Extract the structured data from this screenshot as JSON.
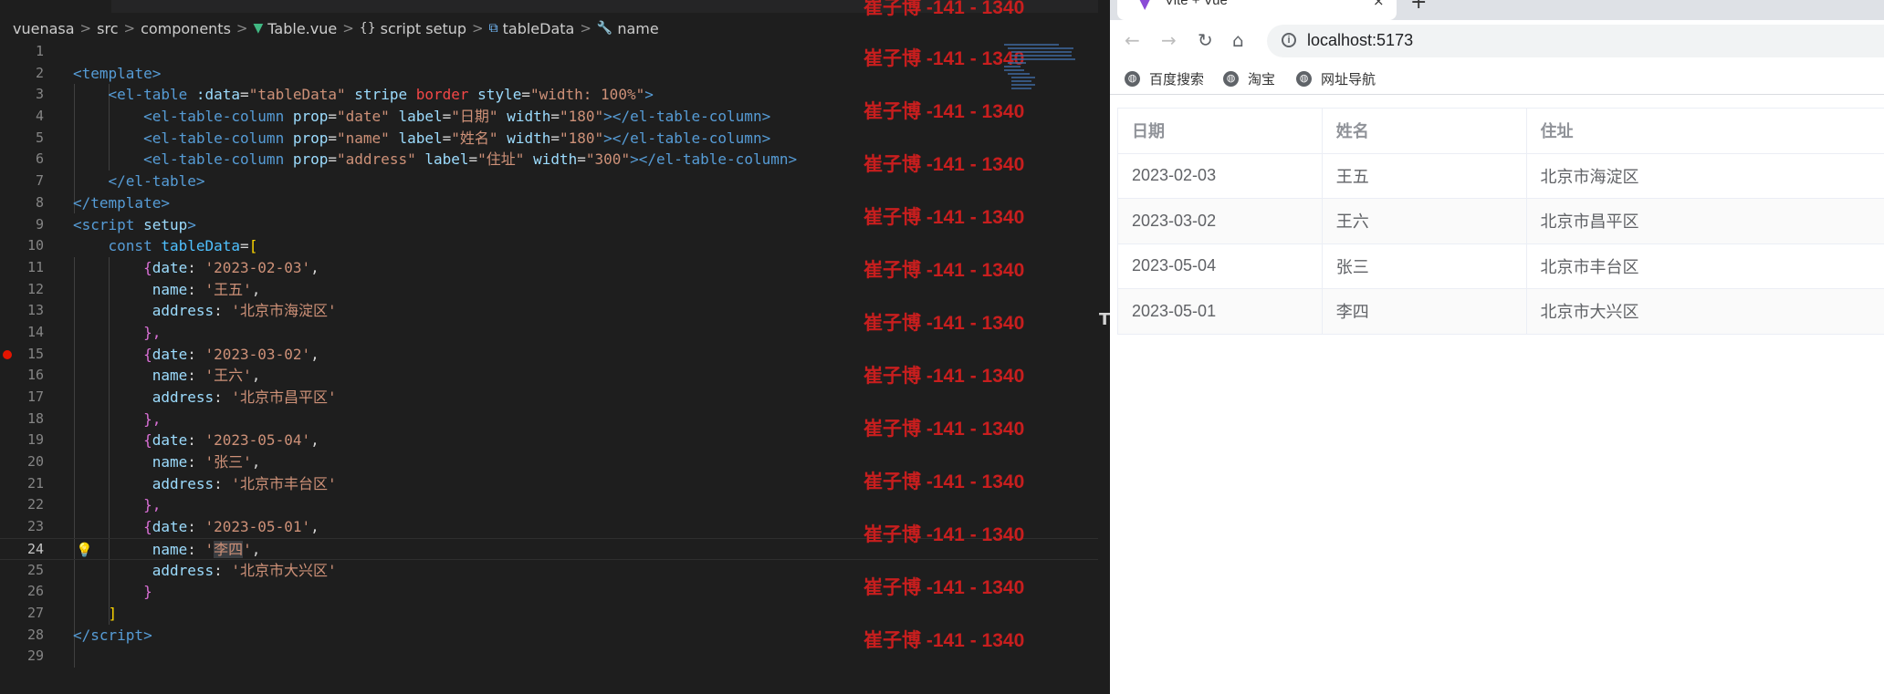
{
  "editor": {
    "breadcrumb": [
      {
        "icon": "none",
        "label": "vuenasa"
      },
      {
        "icon": "none",
        "label": "src"
      },
      {
        "icon": "none",
        "label": "components"
      },
      {
        "icon": "vue-icon",
        "label": "Table.vue"
      },
      {
        "icon": "braces-icon",
        "label": "script setup"
      },
      {
        "icon": "variable-icon",
        "label": "tableData"
      },
      {
        "icon": "wrench-icon",
        "label": "name"
      }
    ],
    "breadcrumb_sep": ">",
    "line_numbers": [
      "1",
      "2",
      "3",
      "4",
      "5",
      "6",
      "7",
      "8",
      "9",
      "10",
      "11",
      "12",
      "13",
      "14",
      "15",
      "16",
      "17",
      "18",
      "19",
      "20",
      "21",
      "22",
      "23",
      "24",
      "25",
      "26",
      "27",
      "28",
      "29"
    ],
    "current_line": "24",
    "breakpoint_line": "15",
    "lightbulb_glyph": "💡",
    "code": {
      "l2": [
        "<",
        "template",
        ">"
      ],
      "l3": [
        "    <",
        "el-table",
        " ",
        ":data",
        "=",
        "\"tableData\"",
        " ",
        "stripe",
        " ",
        "border",
        " ",
        "style",
        "=",
        "\"width: 100%\"",
        ">"
      ],
      "l4": [
        "        <",
        "el-table-column",
        " ",
        "prop",
        "=",
        "\"date\"",
        " ",
        "label",
        "=",
        "\"日期\"",
        " ",
        "width",
        "=",
        "\"180\"",
        "></",
        "el-table-column",
        ">"
      ],
      "l5": [
        "        <",
        "el-table-column",
        " ",
        "prop",
        "=",
        "\"name\"",
        " ",
        "label",
        "=",
        "\"姓名\"",
        " ",
        "width",
        "=",
        "\"180\"",
        "></",
        "el-table-column",
        ">"
      ],
      "l6": [
        "        <",
        "el-table-column",
        " ",
        "prop",
        "=",
        "\"address\"",
        " ",
        "label",
        "=",
        "\"住址\"",
        " ",
        "width",
        "=",
        "\"300\"",
        "></",
        "el-table-column",
        ">"
      ],
      "l7": [
        "    </",
        "el-table",
        ">"
      ],
      "l8": [
        "</",
        "template",
        ">"
      ],
      "l9": [
        "<",
        "script",
        " ",
        "setup",
        ">"
      ],
      "l10": [
        "    ",
        "const",
        " ",
        "tableData",
        "=",
        "["
      ],
      "rows": [
        {
          "date": "'2023-02-03'",
          "name": "'王五'",
          "address": "'北京市海淀区'"
        },
        {
          "date": "'2023-03-02'",
          "name": "'王六'",
          "address": "'北京市昌平区'"
        },
        {
          "date": "'2023-05-04'",
          "name": "'张三'",
          "address": "'北京市丰台区'"
        },
        {
          "date": "'2023-05-01'",
          "name": "李四",
          "address": "'北京市大兴区'"
        }
      ],
      "open_obj": "{",
      "close_obj": "},",
      "close_last": "}",
      "key_date": "date",
      "key_name": "name",
      "key_address": "address",
      "colon": ": ",
      "comma": ",",
      "quote": "'",
      "l27": "]",
      "l28": [
        "</",
        "script",
        ">"
      ]
    },
    "watermark": "崔子博 -141 - 1340",
    "edge_glyph": "T"
  },
  "browser": {
    "tab_title": "Vite + Vue",
    "tab_close": "×",
    "new_tab": "+",
    "url": "localhost:5173",
    "info_glyph": "i",
    "nav": {
      "back": "←",
      "forward": "→",
      "reload": "↻",
      "home": "⌂"
    },
    "bookmarks": [
      "百度搜索",
      "淘宝",
      "网址导航"
    ],
    "table": {
      "headers": [
        "日期",
        "姓名",
        "住址"
      ],
      "rows": [
        [
          "2023-02-03",
          "王五",
          "北京市海淀区"
        ],
        [
          "2023-03-02",
          "王六",
          "北京市昌平区"
        ],
        [
          "2023-05-04",
          "张三",
          "北京市丰台区"
        ],
        [
          "2023-05-01",
          "李四",
          "北京市大兴区"
        ]
      ]
    }
  },
  "colors": {
    "editor_bg": "#1e1e1e",
    "tag": "#569cd6",
    "attr": "#9cdcfe",
    "string": "#ce9178",
    "watermark": "#c81e1e",
    "breakpoint": "#e51400",
    "table_header_text": "#909399",
    "table_cell_text": "#606266",
    "stripe_bg": "#fafafa"
  }
}
